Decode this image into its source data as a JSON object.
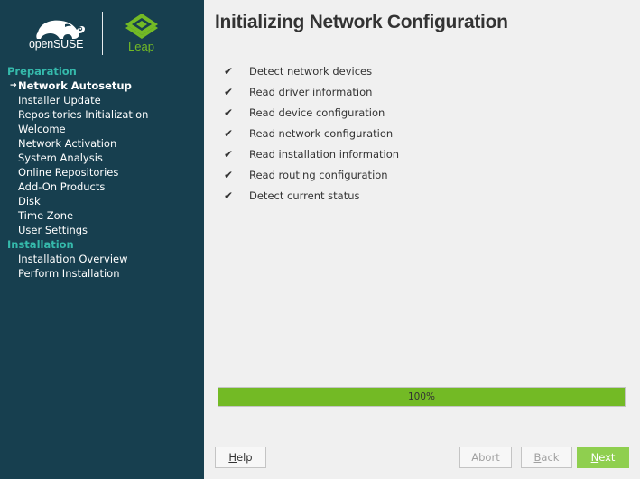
{
  "branding": {
    "opensuse_text": "openSUSE",
    "leap_text": "Leap",
    "colors": {
      "sidebar_bg": "#173f4f",
      "section_heading": "#35b9ab",
      "accent_green": "#73ba25"
    }
  },
  "sidebar": {
    "current_marker": "→",
    "sections": [
      {
        "label": "Preparation",
        "steps": [
          {
            "label": "Network Autosetup",
            "current": true
          },
          {
            "label": "Installer Update"
          },
          {
            "label": "Repositories Initialization"
          },
          {
            "label": "Welcome"
          },
          {
            "label": "Network Activation"
          },
          {
            "label": "System Analysis"
          },
          {
            "label": "Online Repositories"
          },
          {
            "label": "Add-On Products"
          },
          {
            "label": "Disk"
          },
          {
            "label": "Time Zone"
          },
          {
            "label": "User Settings"
          }
        ]
      },
      {
        "label": "Installation",
        "steps": [
          {
            "label": "Installation Overview"
          },
          {
            "label": "Perform Installation"
          }
        ]
      }
    ]
  },
  "main": {
    "title": "Initializing Network Configuration",
    "check_glyph": "✔",
    "tasks": [
      "Detect network devices",
      "Read driver information",
      "Read device configuration",
      "Read network configuration",
      "Read installation information",
      "Read routing configuration",
      "Detect current status"
    ],
    "progress": {
      "value": 100,
      "label": "100%"
    }
  },
  "buttons": {
    "help": {
      "mnemonic": "H",
      "rest": "elp"
    },
    "abort": {
      "mnemonic": "",
      "rest": "Abort"
    },
    "back": {
      "mnemonic": "B",
      "rest": "ack"
    },
    "next": {
      "mnemonic": "N",
      "rest": "ext"
    }
  }
}
